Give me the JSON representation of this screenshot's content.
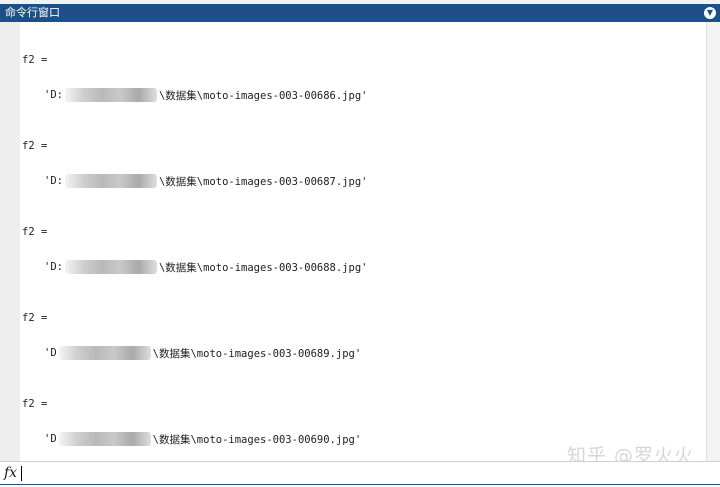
{
  "window": {
    "title": "命令行窗口",
    "menu_icon": "chevron-down-circle-icon"
  },
  "output": [
    {
      "var": "f2 =",
      "prefix": "'D:",
      "suffix": "\\数据集\\moto-images-003-00686.jpg'"
    },
    {
      "var": "f2 =",
      "prefix": "'D:",
      "suffix": "\\数据集\\moto-images-003-00687.jpg'"
    },
    {
      "var": "f2 =",
      "prefix": "'D:",
      "suffix": "\\数据集\\moto-images-003-00688.jpg'"
    },
    {
      "var": "f2 =",
      "prefix": "'D",
      "suffix": "\\数据集\\moto-images-003-00689.jpg'"
    },
    {
      "var": "f2 =",
      "prefix": "'D",
      "suffix": "\\数据集\\moto-images-003-00690.jpg'"
    }
  ],
  "prompt": {
    "fx_label": "fx",
    "value": ""
  },
  "watermark": "知乎 @罗火火"
}
